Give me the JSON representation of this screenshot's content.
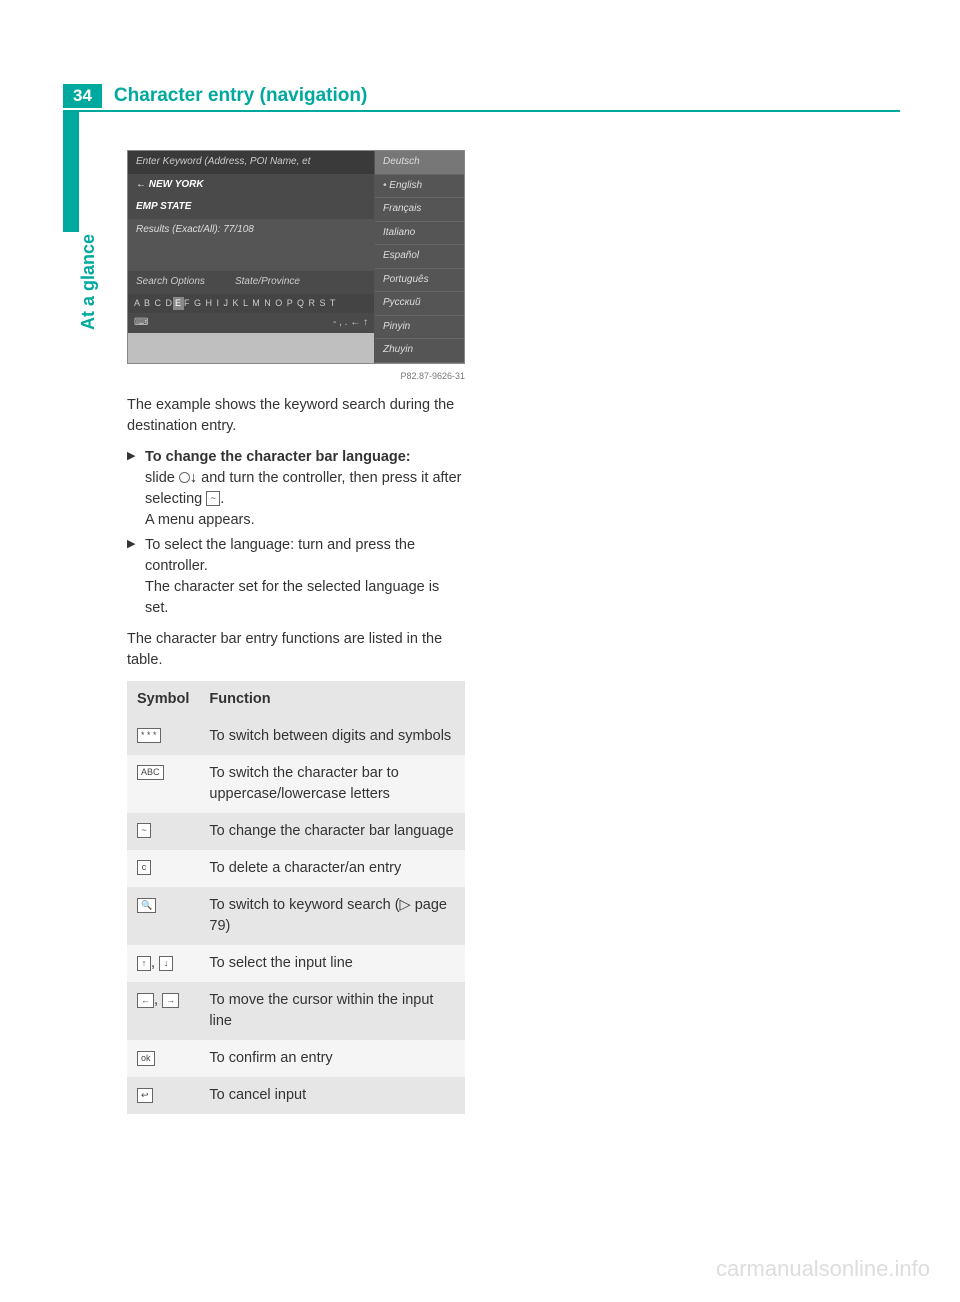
{
  "page_number": "34",
  "section_title": "Character entry (navigation)",
  "side_label": "At a glance",
  "screenshot": {
    "header": "Enter Keyword (Address, POI Name, et",
    "line1_prefix": "←",
    "line1": "NEW YORK",
    "line2": "EMP STATE",
    "results": "Results (Exact/All): 77/108",
    "opt1": "Search Options",
    "opt2": "State/Province",
    "kbd_pre": "A B C D",
    "kbd_hl": "E",
    "kbd_post": "F G H I J K L M N O P Q R S T",
    "bot_left": "⌨",
    "bot_right": "- , . ← ↑",
    "langs": [
      "Deutsch",
      "English",
      "Français",
      "Italiano",
      "Español",
      "Português",
      "Русский",
      "Pinyin",
      "Zhuyin"
    ],
    "img_id": "P82.87-9626-31"
  },
  "caption": "The example shows the keyword search during the destination entry.",
  "step1_title": "To change the character bar language:",
  "step1_body_a": "slide ",
  "step1_body_b": " and turn the controller, then press it after selecting ",
  "step1_body_c": ".",
  "step1_result": "A menu appears.",
  "step2_body": "To select the language: turn and press the controller.",
  "step2_result": "The character set for the selected language is set.",
  "table_intro": "The character bar entry functions are listed in the table.",
  "table_h1": "Symbol",
  "table_h2": "Function",
  "rows": [
    {
      "sym": "* * *",
      "func": "To switch between digits and symbols"
    },
    {
      "sym": "ABC",
      "func": "To switch the character bar to uppercase/lowercase letters"
    },
    {
      "sym": "~",
      "func": "To change the character bar language"
    },
    {
      "sym": "c",
      "func": "To delete a character/an entry"
    },
    {
      "sym": "🔍",
      "func": "To switch to keyword search (▷ page 79)"
    },
    {
      "sym": "↑, ↓",
      "func": "To select the input line",
      "split": true
    },
    {
      "sym": "←, →",
      "func": "To move the cursor within the input line",
      "split": true
    },
    {
      "sym": "ok",
      "func": "To confirm an entry"
    },
    {
      "sym": "↩",
      "func": "To cancel input"
    }
  ],
  "watermark": "carmanualsonline.info"
}
